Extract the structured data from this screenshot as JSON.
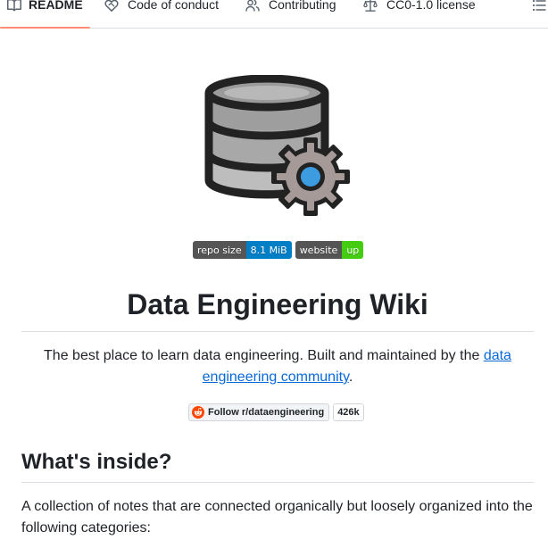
{
  "tabs": [
    {
      "label": "README",
      "icon": "book-icon",
      "active": true
    },
    {
      "label": "Code of conduct",
      "icon": "heart-handshake-icon",
      "active": false
    },
    {
      "label": "Contributing",
      "icon": "people-icon",
      "active": false
    },
    {
      "label": "CC0-1.0 license",
      "icon": "law-scale-icon",
      "active": false
    }
  ],
  "outline_icon": "list-unordered-icon",
  "badges": {
    "repo_size": {
      "label": "repo size",
      "value": "8.1 MiB",
      "value_color": "#007ec6"
    },
    "website": {
      "label": "website",
      "value": "up",
      "value_color": "#44cc11"
    }
  },
  "title": "Data Engineering Wiki",
  "tagline": {
    "text": "The best place to learn data engineering. Built and maintained by the ",
    "link_text": "data engineering community",
    "suffix": "."
  },
  "reddit": {
    "label": "Follow r/dataengineering",
    "count": "426k"
  },
  "section_heading": "What's inside?",
  "section_text": "A collection of notes that are connected organically but loosely organized into the following categories:",
  "colors": {
    "accent_underline": "#fd8c73",
    "link": "#0969da",
    "text": "#1f2328"
  }
}
